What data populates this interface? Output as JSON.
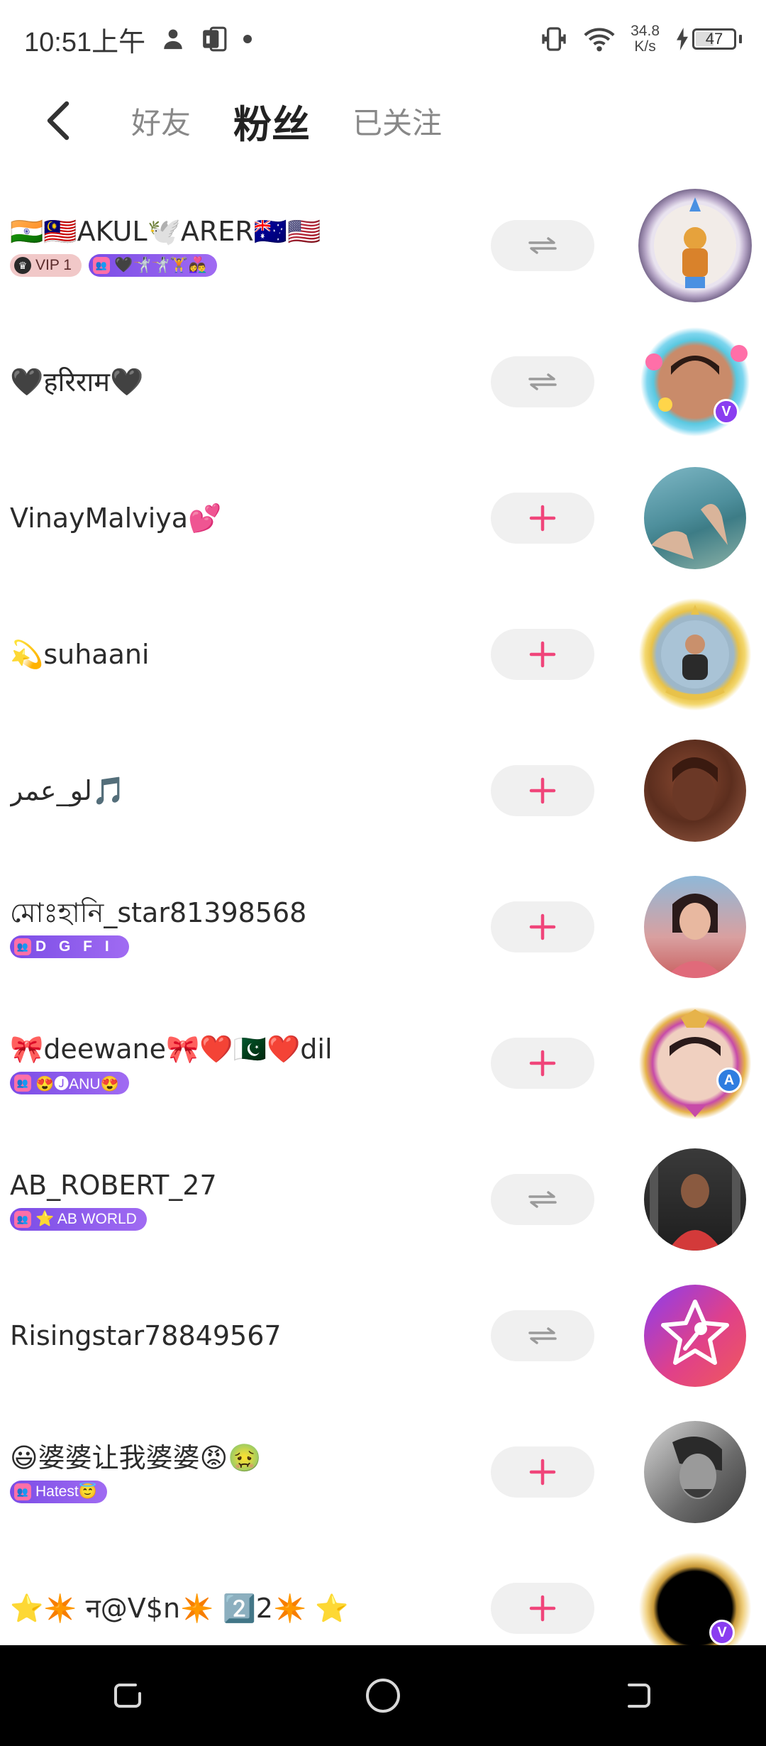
{
  "status_bar": {
    "time": "10:51上午",
    "net_speed_value": "34.8",
    "net_speed_unit": "K/s",
    "battery": "47",
    "icons": [
      "person-icon",
      "app-notification-icon",
      "dot-icon",
      "vibrate-icon",
      "wifi-icon",
      "charging-icon",
      "battery-icon"
    ]
  },
  "header": {
    "tabs": [
      {
        "label": "好友",
        "active": false
      },
      {
        "label": "粉丝",
        "active": true
      },
      {
        "label": "已关注",
        "active": false
      }
    ]
  },
  "users": [
    {
      "name": "🇮🇳🇲🇾AKUL🕊️ARER🇦🇺🇺🇸",
      "vip": "VIP 1",
      "family": "🖤🤺🤺🏋️👩‍❤️‍👨",
      "action": "mutual"
    },
    {
      "name": "🖤हरिराम🖤",
      "action": "mutual"
    },
    {
      "name": "VinayMalviya💕",
      "action": "follow"
    },
    {
      "name": "💫suhaani",
      "action": "follow"
    },
    {
      "name": "لو_عمر🎵",
      "action": "follow"
    },
    {
      "name": "মোঃহানি_star81398568",
      "family": "D G F I",
      "action": "follow"
    },
    {
      "name": "🎀deewane🎀❤️🇵🇰❤️dil",
      "family": "😍🅙ANU😍",
      "action": "follow"
    },
    {
      "name": "AB_ROBERT_27",
      "family": "⭐ AB WORLD",
      "action": "mutual"
    },
    {
      "name": "Risingstar78849567",
      "action": "mutual"
    },
    {
      "name": "😃婆婆让我婆婆😡🤢",
      "family": "Hatest😇",
      "action": "follow"
    },
    {
      "name": "⭐✴️ न@V$n✴️ 2️⃣2✴️ ⭐",
      "action": "follow"
    }
  ],
  "colors": {
    "follow_plus": "#f0457a",
    "mutual_icon": "#9a9a9a",
    "button_bg": "#f0f0f0",
    "badge_purple": "#7b4de6"
  }
}
